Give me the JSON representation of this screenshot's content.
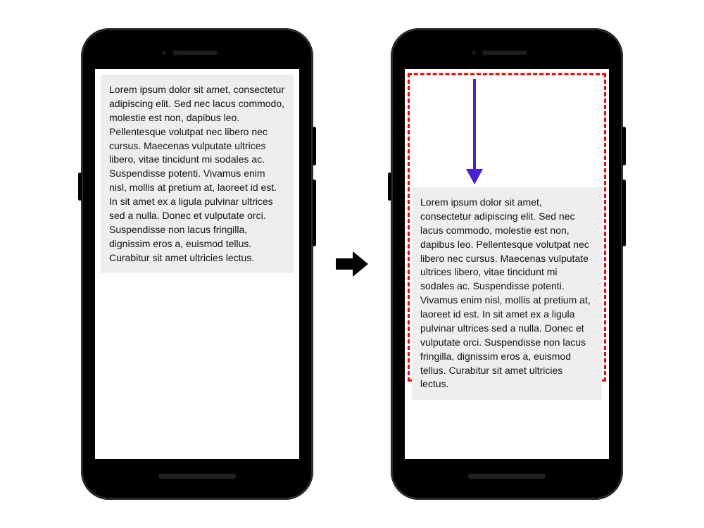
{
  "lorem_text": "Lorem ipsum dolor sit amet, consectetur adipiscing elit. Sed nec lacus commodo, molestie est non, dapibus leo. Pellentesque volutpat nec libero nec cursus. Maecenas vulputate ultrices libero, vitae tincidunt mi sodales ac. Suspendisse potenti. Vivamus enim nisl, mollis at pretium at, laoreet id est. In sit amet ex a ligula pulvinar ultrices sed a nulla. Donec et vulputate orci. Suspendisse non lacus fringilla, dignissim eros a, euismod tellus. Curabitur sit amet ultricies lectus.",
  "colors": {
    "dashed_border": "#ff0000",
    "move_arrow": "#4b1fd6",
    "text_card_bg": "#eeeeee",
    "transition_arrow": "#000000"
  },
  "icons": {
    "transition_arrow": "right-arrow",
    "move_arrow": "down-arrow"
  }
}
